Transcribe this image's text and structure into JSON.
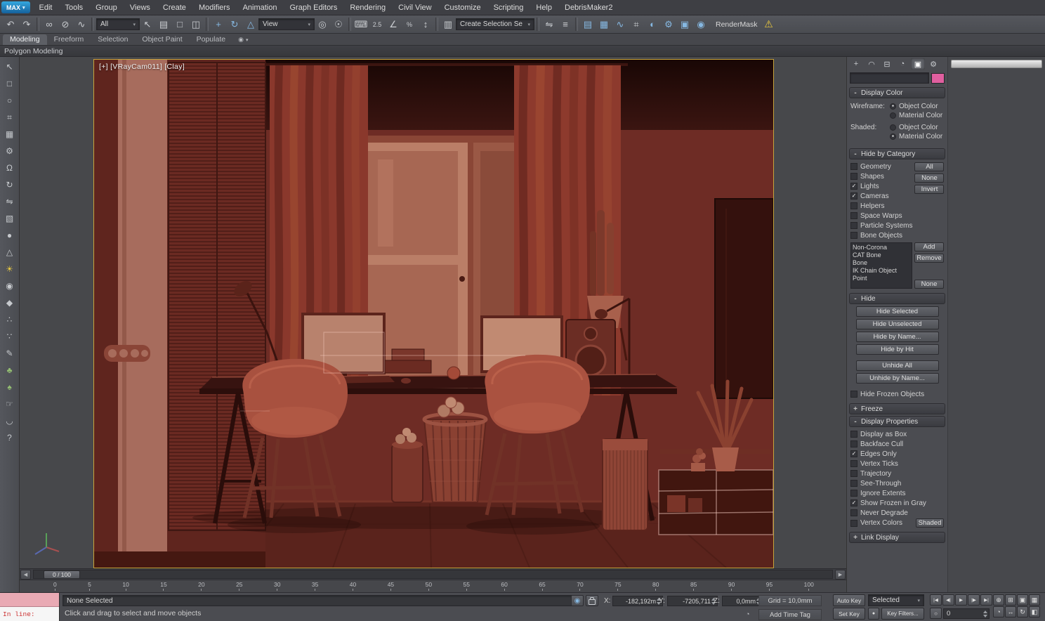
{
  "app": {
    "logo": "MAX"
  },
  "menubar": {
    "items": [
      "Edit",
      "Tools",
      "Group",
      "Views",
      "Create",
      "Modifiers",
      "Animation",
      "Graph Editors",
      "Rendering",
      "Civil View",
      "Customize",
      "Scripting",
      "Help",
      "DebrisMaker2"
    ]
  },
  "toolbar": {
    "icons_a": [
      {
        "name": "undo-icon",
        "glyph": "↶"
      },
      {
        "name": "redo-icon",
        "glyph": "↷"
      }
    ],
    "icons_b": [
      {
        "name": "select-and-link-icon",
        "glyph": "∞"
      },
      {
        "name": "unlink-selection-icon",
        "glyph": "⊘"
      },
      {
        "name": "bind-to-spacewarp-icon",
        "glyph": "∿"
      }
    ],
    "filter_value": "All",
    "icons_c": [
      {
        "name": "select-object-icon",
        "glyph": "↖"
      },
      {
        "name": "select-by-name-icon",
        "glyph": "▤"
      },
      {
        "name": "rectangular-region-icon",
        "glyph": "□"
      },
      {
        "name": "window-crossing-icon",
        "glyph": "◫"
      }
    ],
    "icons_d": [
      {
        "name": "select-and-move-icon",
        "glyph": "+",
        "cls": "blue"
      },
      {
        "name": "select-and-rotate-icon",
        "glyph": "↻",
        "cls": "blue"
      },
      {
        "name": "select-and-scale-icon",
        "glyph": "△",
        "cls": "blue"
      }
    ],
    "coord_value": "View",
    "icons_e": [
      {
        "name": "use-pivot-center-icon",
        "glyph": "◎"
      },
      {
        "name": "select-and-manipulate-icon",
        "glyph": "☉"
      }
    ],
    "icons_f": [
      {
        "name": "keyboard-override-icon",
        "glyph": "⌨"
      },
      {
        "name": "snaps-toggle-icon",
        "glyph": "2.5",
        "cls": "small"
      },
      {
        "name": "angle-snap-icon",
        "glyph": "∠"
      },
      {
        "name": "percent-snap-icon",
        "glyph": "%",
        "cls": "small"
      },
      {
        "name": "spinner-snap-icon",
        "glyph": "↕"
      }
    ],
    "icons_g": [
      {
        "name": "edit-named-selections-icon",
        "glyph": "▥"
      }
    ],
    "selection_set_value": "Create Selection Se",
    "icons_h": [
      {
        "name": "mirror-icon",
        "glyph": "⇋"
      },
      {
        "name": "align-icon",
        "glyph": "≡"
      }
    ],
    "icons_i": [
      {
        "name": "layer-manager-icon",
        "glyph": "▤",
        "cls": "blue"
      },
      {
        "name": "ribbon-toggle-icon",
        "glyph": "▦",
        "cls": "blue"
      },
      {
        "name": "curve-editor-icon",
        "glyph": "∿",
        "cls": "blue"
      },
      {
        "name": "schematic-view-icon",
        "glyph": "⌗"
      },
      {
        "name": "material-editor-icon",
        "glyph": "◐",
        "cls": "blue"
      },
      {
        "name": "render-setup-icon",
        "glyph": "⚙",
        "cls": "blue"
      },
      {
        "name": "rendered-frame-icon",
        "glyph": "▣",
        "cls": "blue"
      },
      {
        "name": "render-production-icon",
        "glyph": "◉",
        "cls": "blue"
      }
    ],
    "rendermask_label": "RenderMask",
    "warning_icon": "⚠"
  },
  "ribbon": {
    "tabs": [
      {
        "label": "Modeling",
        "cls": "active"
      },
      {
        "label": "Freeform",
        "cls": ""
      },
      {
        "label": "Selection",
        "cls": ""
      },
      {
        "label": "Object Paint",
        "cls": ""
      },
      {
        "label": "Populate",
        "cls": ""
      }
    ],
    "menu_icon": "◉",
    "subtab": "Polygon Modeling"
  },
  "left_toolbar": {
    "icons": [
      {
        "name": "select-icon",
        "glyph": "↖",
        "cls": ""
      },
      {
        "name": "rectangle-tool-icon",
        "glyph": "□",
        "cls": ""
      },
      {
        "name": "circle-tool-icon",
        "glyph": "○",
        "cls": ""
      },
      {
        "name": "lattice-icon",
        "glyph": "⌗",
        "cls": ""
      },
      {
        "name": "grid-array-icon",
        "glyph": "▦",
        "cls": ""
      },
      {
        "name": "gear-icon",
        "glyph": "⚙",
        "cls": ""
      },
      {
        "name": "magnet-icon",
        "glyph": "Ω",
        "cls": ""
      },
      {
        "name": "rotate-tool-icon",
        "glyph": "↻",
        "cls": ""
      },
      {
        "name": "mirror-tool-icon",
        "glyph": "⇋",
        "cls": ""
      },
      {
        "name": "box-primitive-icon",
        "glyph": "▧",
        "cls": ""
      },
      {
        "name": "sphere-primitive-icon",
        "glyph": "●",
        "cls": ""
      },
      {
        "name": "cone-primitive-icon",
        "glyph": "△",
        "cls": ""
      },
      {
        "name": "light-icon",
        "glyph": "☀",
        "cls": "yellow"
      },
      {
        "name": "geosphere-icon",
        "glyph": "◉",
        "cls": ""
      },
      {
        "name": "hedra-icon",
        "glyph": "◆",
        "cls": ""
      },
      {
        "name": "scatter-icon",
        "glyph": "∴",
        "cls": ""
      },
      {
        "name": "spray-icon",
        "glyph": "∵",
        "cls": ""
      },
      {
        "name": "paint-icon",
        "glyph": "✎",
        "cls": ""
      },
      {
        "name": "foliage-icon",
        "glyph": "♣",
        "cls": "green"
      },
      {
        "name": "grass-icon",
        "glyph": "♠",
        "cls": "green"
      },
      {
        "name": "hand-tool-icon",
        "glyph": "☞",
        "cls": ""
      },
      {
        "name": "bone-tool-icon",
        "glyph": "◡",
        "cls": ""
      },
      {
        "name": "help-icon",
        "glyph": "?",
        "cls": ""
      }
    ]
  },
  "viewport": {
    "label": "[+] [VRayCam011] [Clay]"
  },
  "command_panel": {
    "tabs": [
      {
        "name": "create-tab",
        "glyph": "+",
        "cls": ""
      },
      {
        "name": "modify-tab",
        "glyph": "◠",
        "cls": ""
      },
      {
        "name": "hierarchy-tab",
        "glyph": "⊟",
        "cls": ""
      },
      {
        "name": "motion-tab",
        "glyph": "◔",
        "cls": ""
      },
      {
        "name": "display-tab",
        "glyph": "▣",
        "cls": "active"
      },
      {
        "name": "utilities-tab",
        "glyph": "⚙",
        "cls": ""
      }
    ],
    "name_field": {
      "value": "",
      "swatch_color": "#e05f9f"
    },
    "display_color": {
      "sign": "-",
      "title": "Display Color",
      "wireframe_label": "Wireframe:",
      "wireframe_options": [
        {
          "label": "Object Color",
          "dot": "●"
        },
        {
          "label": "Material Color",
          "dot": ""
        }
      ],
      "shaded_label": "Shaded:",
      "shaded_options": [
        {
          "label": "Object Color",
          "dot": ""
        },
        {
          "label": "Material Color",
          "dot": "●"
        }
      ]
    },
    "hide_by_category": {
      "sign": "-",
      "title": "Hide by Category",
      "categories": [
        {
          "label": "Geometry",
          "check": ""
        },
        {
          "label": "Shapes",
          "check": ""
        },
        {
          "label": "Lights",
          "check": "✓"
        },
        {
          "label": "Cameras",
          "check": "✓"
        },
        {
          "label": "Helpers",
          "check": ""
        },
        {
          "label": "Space Warps",
          "check": ""
        },
        {
          "label": "Particle Systems",
          "check": ""
        },
        {
          "label": "Bone Objects",
          "check": ""
        }
      ],
      "side_buttons": [
        "All",
        "None",
        "Invert"
      ],
      "exclude_list": [
        "Non-Corona",
        "CAT Bone",
        "Bone",
        "IK Chain Object",
        "Point"
      ],
      "add_button": "Add",
      "remove_button": "Remove",
      "none_button": "None"
    },
    "hide": {
      "sign": "-",
      "title": "Hide",
      "buttons_a": [
        "Hide Selected",
        "Hide Unselected",
        "Hide by Name...",
        "Hide by Hit"
      ],
      "buttons_b": [
        "Unhide All",
        "Unhide by Name..."
      ],
      "frozen_checkbox": {
        "label": "Hide Frozen Objects",
        "check": ""
      }
    },
    "freeze": {
      "sign": "+",
      "title": "Freeze"
    },
    "display_properties": {
      "sign": "-",
      "title": "Display Properties",
      "items": [
        {
          "label": "Display as Box",
          "check": ""
        },
        {
          "label": "Backface Cull",
          "check": ""
        },
        {
          "label": "Edges Only",
          "check": "✓"
        },
        {
          "label": "Vertex Ticks",
          "check": ""
        },
        {
          "label": "Trajectory",
          "check": ""
        },
        {
          "label": "See-Through",
          "check": ""
        },
        {
          "label": "Ignore Extents",
          "check": ""
        },
        {
          "label": "Show Frozen in Gray",
          "check": "✓"
        },
        {
          "label": "Never Degrade",
          "check": ""
        }
      ],
      "vertex_colors": {
        "label": "Vertex Colors",
        "check": ""
      },
      "shaded_button": "Shaded"
    },
    "link_display": {
      "sign": "+",
      "title": "Link Display"
    }
  },
  "timeline": {
    "slider_label": "0 / 100",
    "left_arrow": "◀",
    "right_arrow": "▶",
    "ticks": [
      "0",
      "5",
      "10",
      "15",
      "20",
      "25",
      "30",
      "35",
      "40",
      "45",
      "50",
      "55",
      "60",
      "65",
      "70",
      "75",
      "80",
      "85",
      "90",
      "95",
      "100"
    ]
  },
  "statusbar": {
    "listener_line": "In line:",
    "selection_status": "None Selected",
    "prompt": "Click and drag to select and move objects",
    "isolate_icon": "◉",
    "coords": {
      "x_label": "X:",
      "x": "-182,192m",
      "y_label": "Y:",
      "y": "-7205,711",
      "z_label": "Z:",
      "z": "0,0mm"
    },
    "grid": "Grid = 10,0mm",
    "add_time_tag": "Add Time Tag",
    "time_tag_icon": "◔",
    "auto_key": "Auto Key",
    "selected_value": "Selected",
    "set_key": "Set Key",
    "key_mode_icon": "●",
    "key_filters": "Key Filters...",
    "time_value": "0",
    "playback": [
      {
        "name": "go-to-start-icon",
        "glyph": "|◀"
      },
      {
        "name": "previous-frame-icon",
        "glyph": "◀|"
      },
      {
        "name": "play-icon",
        "glyph": "▶"
      },
      {
        "name": "next-frame-icon",
        "glyph": "|▶"
      },
      {
        "name": "go-to-end-icon",
        "glyph": "▶|"
      }
    ],
    "keystep_icon": "○",
    "nav": [
      {
        "name": "zoom-icon",
        "glyph": "⊕"
      },
      {
        "name": "zoom-all-icon",
        "glyph": "⊞"
      },
      {
        "name": "zoom-extents-icon",
        "glyph": "▣"
      },
      {
        "name": "zoom-extents-all-icon",
        "glyph": "▦"
      },
      {
        "name": "zoom-region-icon",
        "glyph": "◔"
      },
      {
        "name": "pan-icon",
        "glyph": "↔"
      },
      {
        "name": "orbit-icon",
        "glyph": "↻"
      },
      {
        "name": "maximize-viewport-icon",
        "glyph": "◧"
      }
    ]
  },
  "colors": {
    "viewport_border": "#c7a43b",
    "object_color": "#e05f9f",
    "clay_render": "#8a3a2e",
    "ui_background": "#4b4c51"
  }
}
